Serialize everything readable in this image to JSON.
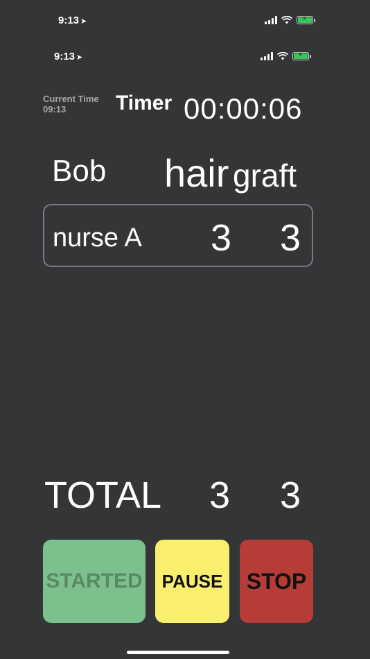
{
  "status_bar": {
    "time": "9:13",
    "location_glyph": "➤"
  },
  "inner_status_bar": {
    "time": "9:13",
    "location_glyph": "➤"
  },
  "header": {
    "current_time_label": "Current Time",
    "current_time_value": "09:13",
    "timer_label": "Timer",
    "timer_value": "00:00:06"
  },
  "columns": {
    "name": "Bob",
    "hair": "hair",
    "graft": "graft"
  },
  "rows": [
    {
      "name": "nurse A",
      "hair": "3",
      "graft": "3"
    }
  ],
  "totals": {
    "label": "TOTAL",
    "hair": "3",
    "graft": "3"
  },
  "buttons": {
    "start": "STARTED",
    "pause": "PAUSE",
    "stop": "STOP"
  },
  "colors": {
    "background": "#343537",
    "start_button": "#7cc08e",
    "pause_button": "#f9ee6e",
    "stop_button": "#b53c37",
    "battery": "#35c759"
  },
  "icons": [
    "location-arrow-icon",
    "cellular-signal-icon",
    "wifi-icon",
    "battery-charging-icon"
  ]
}
